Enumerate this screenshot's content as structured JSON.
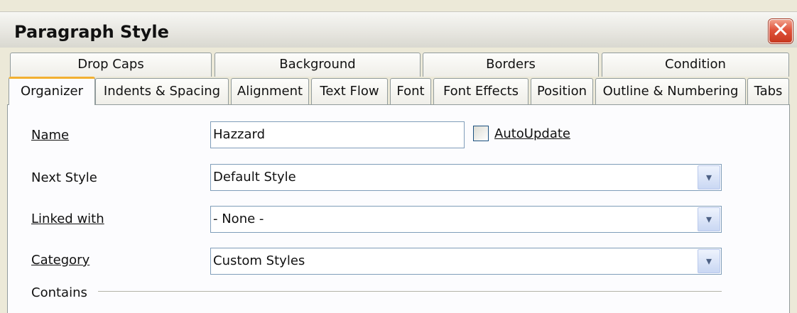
{
  "dialog": {
    "title": "Paragraph Style",
    "close_glyph": "✕"
  },
  "tabs_row1": [
    {
      "label": "Drop Caps"
    },
    {
      "label": "Background"
    },
    {
      "label": "Borders"
    },
    {
      "label": "Condition"
    }
  ],
  "tabs_row2": [
    {
      "label": "Organizer",
      "active": true
    },
    {
      "label": "Indents & Spacing"
    },
    {
      "label": "Alignment"
    },
    {
      "label": "Text Flow"
    },
    {
      "label": "Font"
    },
    {
      "label": "Font Effects"
    },
    {
      "label": "Position"
    },
    {
      "label": "Outline & Numbering"
    },
    {
      "label": "Tabs"
    }
  ],
  "form": {
    "name_label": "Name",
    "name_value": "Hazzard",
    "autoupdate_label": "AutoUpdate",
    "autoupdate_checked": false,
    "next_style_label": "Next Style",
    "next_style_value": "Default Style",
    "linked_with_label": "Linked with",
    "linked_with_value": "- None -",
    "category_label": "Category",
    "category_value": "Custom Styles",
    "contains_label": "Contains",
    "dropdown_glyph": "▾"
  },
  "colors": {
    "dialog_bg": "#ece9d8",
    "active_tab_accent": "#f2b032",
    "close_button": "#e0533b"
  }
}
